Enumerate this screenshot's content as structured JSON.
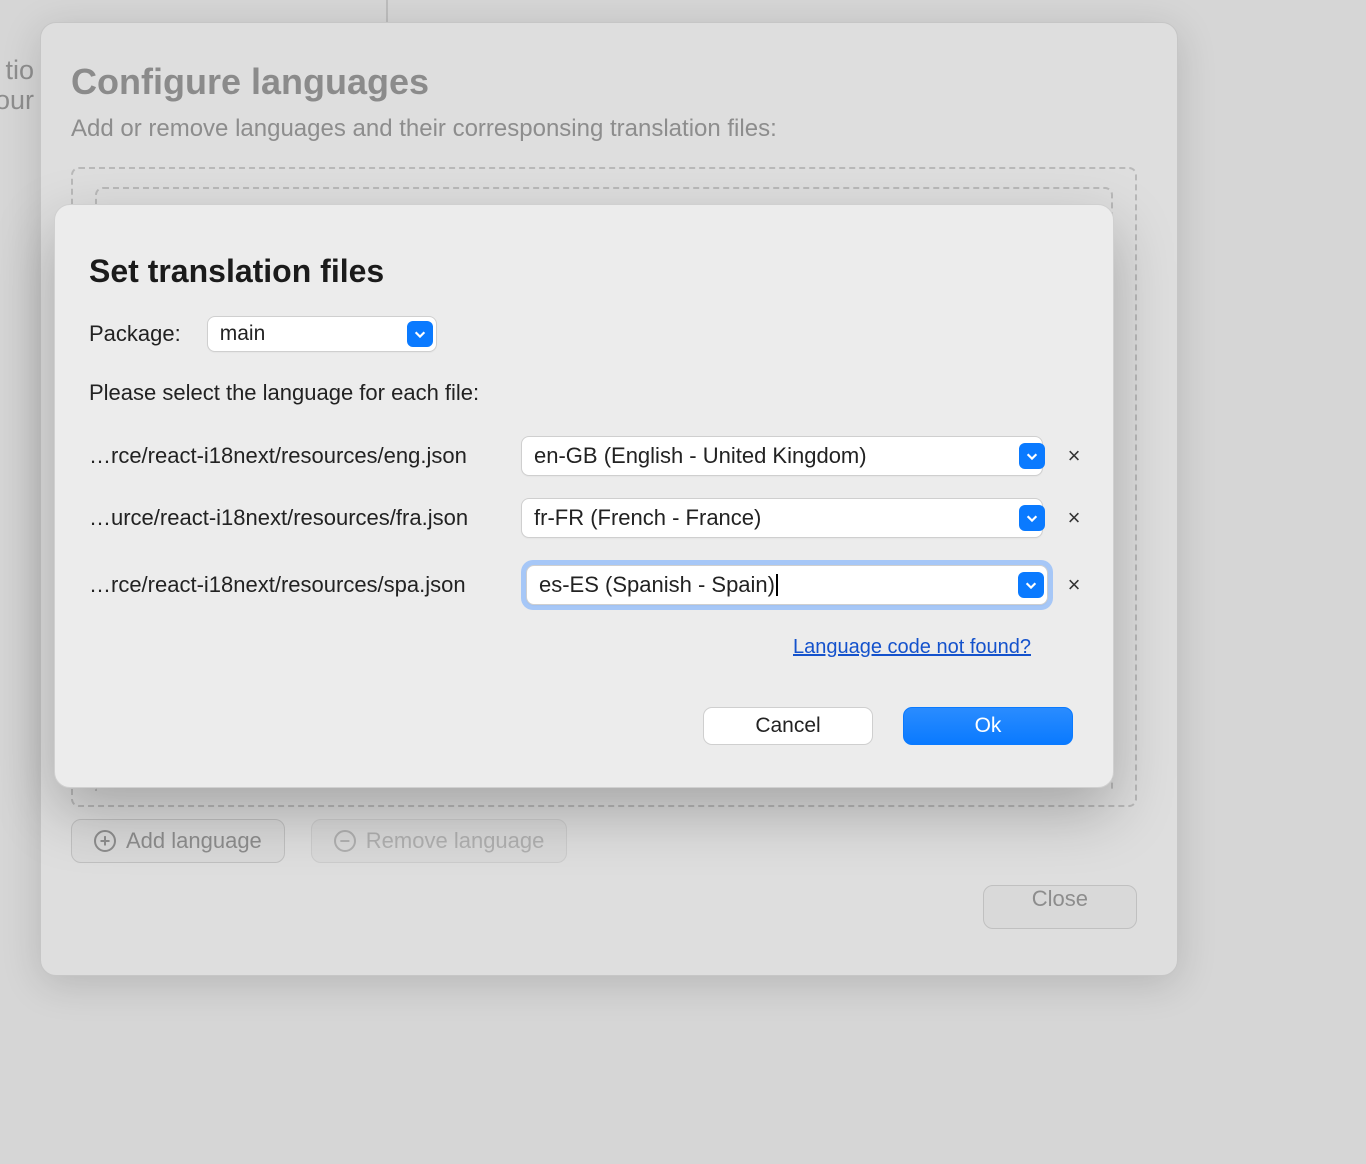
{
  "background": {
    "left_partial_line1": "tio",
    "left_partial_line2": "our"
  },
  "panel_back": {
    "title": "Configure languages",
    "subtitle": "Add or remove languages and their corresponsing translation files:",
    "add_label": "Add language",
    "remove_label": "Remove language",
    "close_label": "Close"
  },
  "modal": {
    "title": "Set translation files",
    "package_label": "Package:",
    "package_value": "main",
    "instruction": "Please select the language for each file:",
    "rows": [
      {
        "path": "…rce/react-i18next/resources/eng.json",
        "lang": "en-GB (English - United Kingdom)"
      },
      {
        "path": "…urce/react-i18next/resources/fra.json",
        "lang": "fr-FR (French - France)"
      },
      {
        "path": "…rce/react-i18next/resources/spa.json",
        "lang": "es-ES (Spanish - Spain)"
      }
    ],
    "remove_glyph": "×",
    "help_link": "Language code not found?",
    "cancel_label": "Cancel",
    "ok_label": "Ok"
  },
  "colors": {
    "accent": "#0a7aff",
    "link": "#1452cc"
  }
}
